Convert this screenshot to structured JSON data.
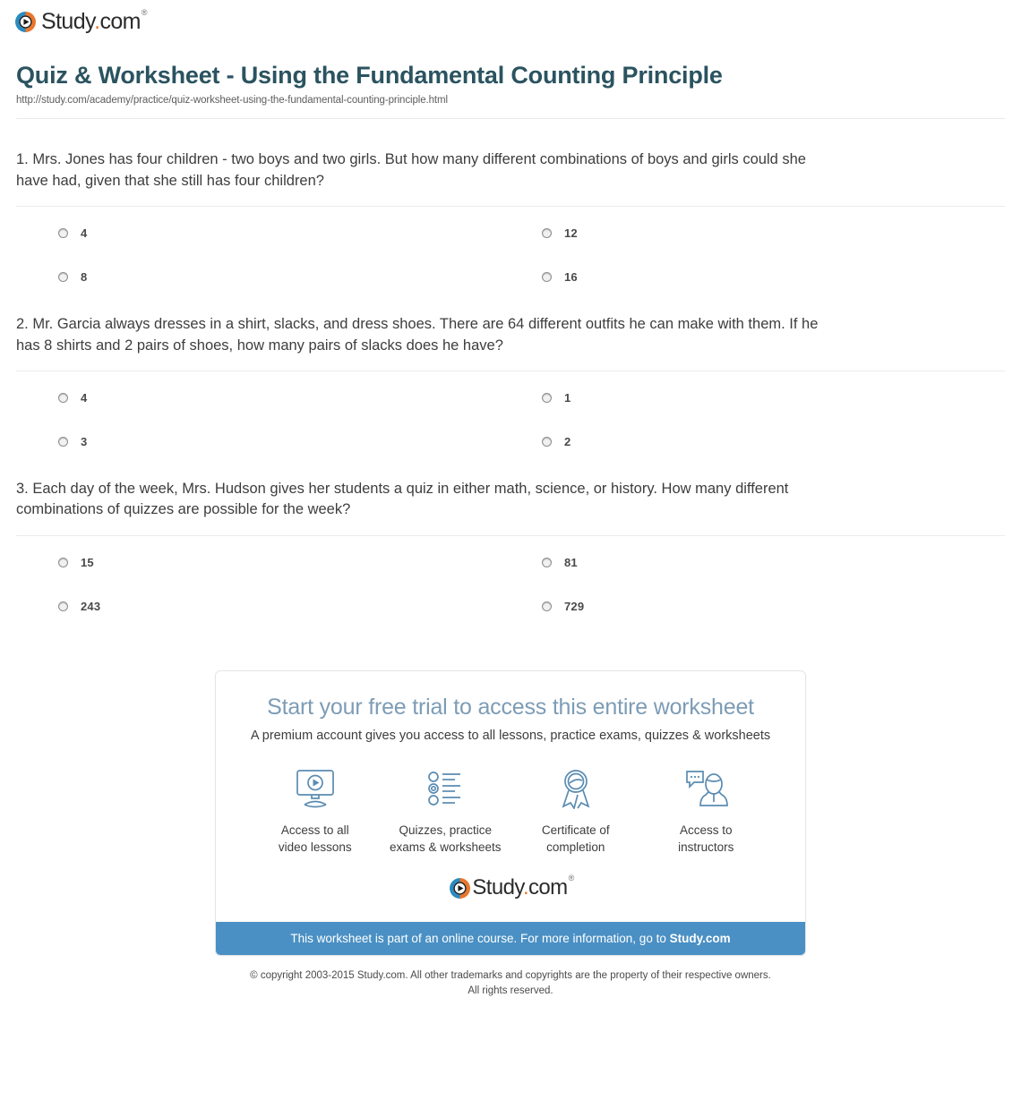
{
  "brand": {
    "name": "Study",
    "dot": ".",
    "tld": "com",
    "tm": "®",
    "logo_icon": "study-play-circle-icon",
    "blue": "#2a8bbf",
    "orange": "#e8762c"
  },
  "header": {
    "title": "Quiz & Worksheet - Using the Fundamental Counting Principle",
    "url": "http://study.com/academy/practice/quiz-worksheet-using-the-fundamental-counting-principle.html",
    "title_color": "#2b5360"
  },
  "questions": [
    {
      "number": "1.",
      "text": "1. Mrs. Jones has four children - two boys and two girls. But how many different combinations of boys and girls could she have had, given that she still has four children?",
      "options": [
        "4",
        "12",
        "8",
        "16"
      ]
    },
    {
      "number": "2.",
      "text": "2. Mr. Garcia always dresses in a shirt, slacks, and dress shoes. There are 64 different outfits he can make with them. If he has 8 shirts and 2 pairs of shoes, how many pairs of slacks does he have?",
      "options": [
        "4",
        "1",
        "3",
        "2"
      ]
    },
    {
      "number": "3.",
      "text": "3. Each day of the week, Mrs. Hudson gives her students a quiz in either math, science, or history. How many different combinations of quizzes are possible for the week?",
      "options": [
        "15",
        "81",
        "243",
        "729"
      ]
    }
  ],
  "promo": {
    "title": "Start your free trial to access this entire worksheet",
    "subtitle": "A premium account gives you access to all lessons, practice exams, quizzes & worksheets",
    "title_color": "#7d9cb5",
    "features": [
      {
        "icon": "monitor-play-icon",
        "label": "Access to all\nvideo lessons",
        "line1": "Access to all",
        "line2": "video lessons"
      },
      {
        "icon": "quiz-list-icon",
        "label": "Quizzes, practice\nexams & worksheets",
        "line1": "Quizzes, practice",
        "line2": "exams & worksheets"
      },
      {
        "icon": "award-ribbon-icon",
        "label": "Certificate of\ncompletion",
        "line1": "Certificate of",
        "line2": "completion"
      },
      {
        "icon": "instructor-chat-icon",
        "label": "Access to\ninstructors",
        "line1": "Access to",
        "line2": "instructors"
      }
    ],
    "banner_text": "This worksheet is part of an online course. For more information, go to ",
    "banner_link": "Study.com",
    "banner_color": "#4a90c4"
  },
  "footer": {
    "line1": "© copyright 2003-2015 Study.com. All other trademarks and copyrights are the property of their respective owners.",
    "line2": "All rights reserved."
  }
}
